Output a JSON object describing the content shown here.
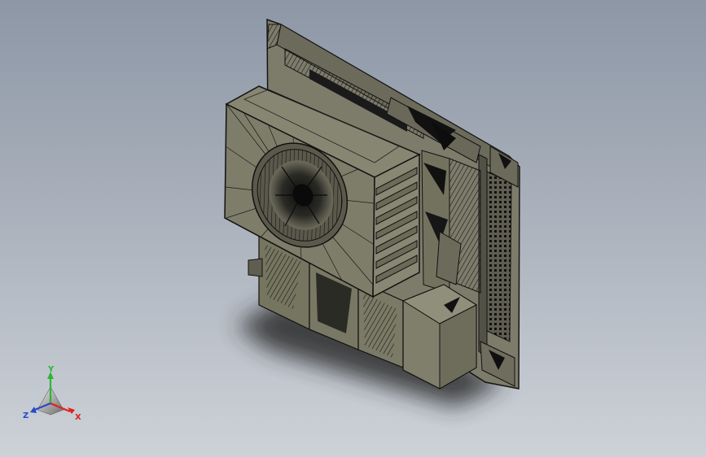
{
  "viewport": {
    "background_top": "#8d97a6",
    "background_bottom": "#cdd2d8",
    "model_color": "#7c7b69",
    "model_edge_color": "#141414",
    "shadow_color": "#2c2c2c"
  },
  "triad": {
    "x_label": "X",
    "y_label": "Y",
    "z_label": "Z",
    "x_color": "#e0211e",
    "y_color": "#2fb43a",
    "z_color": "#2748c8"
  }
}
